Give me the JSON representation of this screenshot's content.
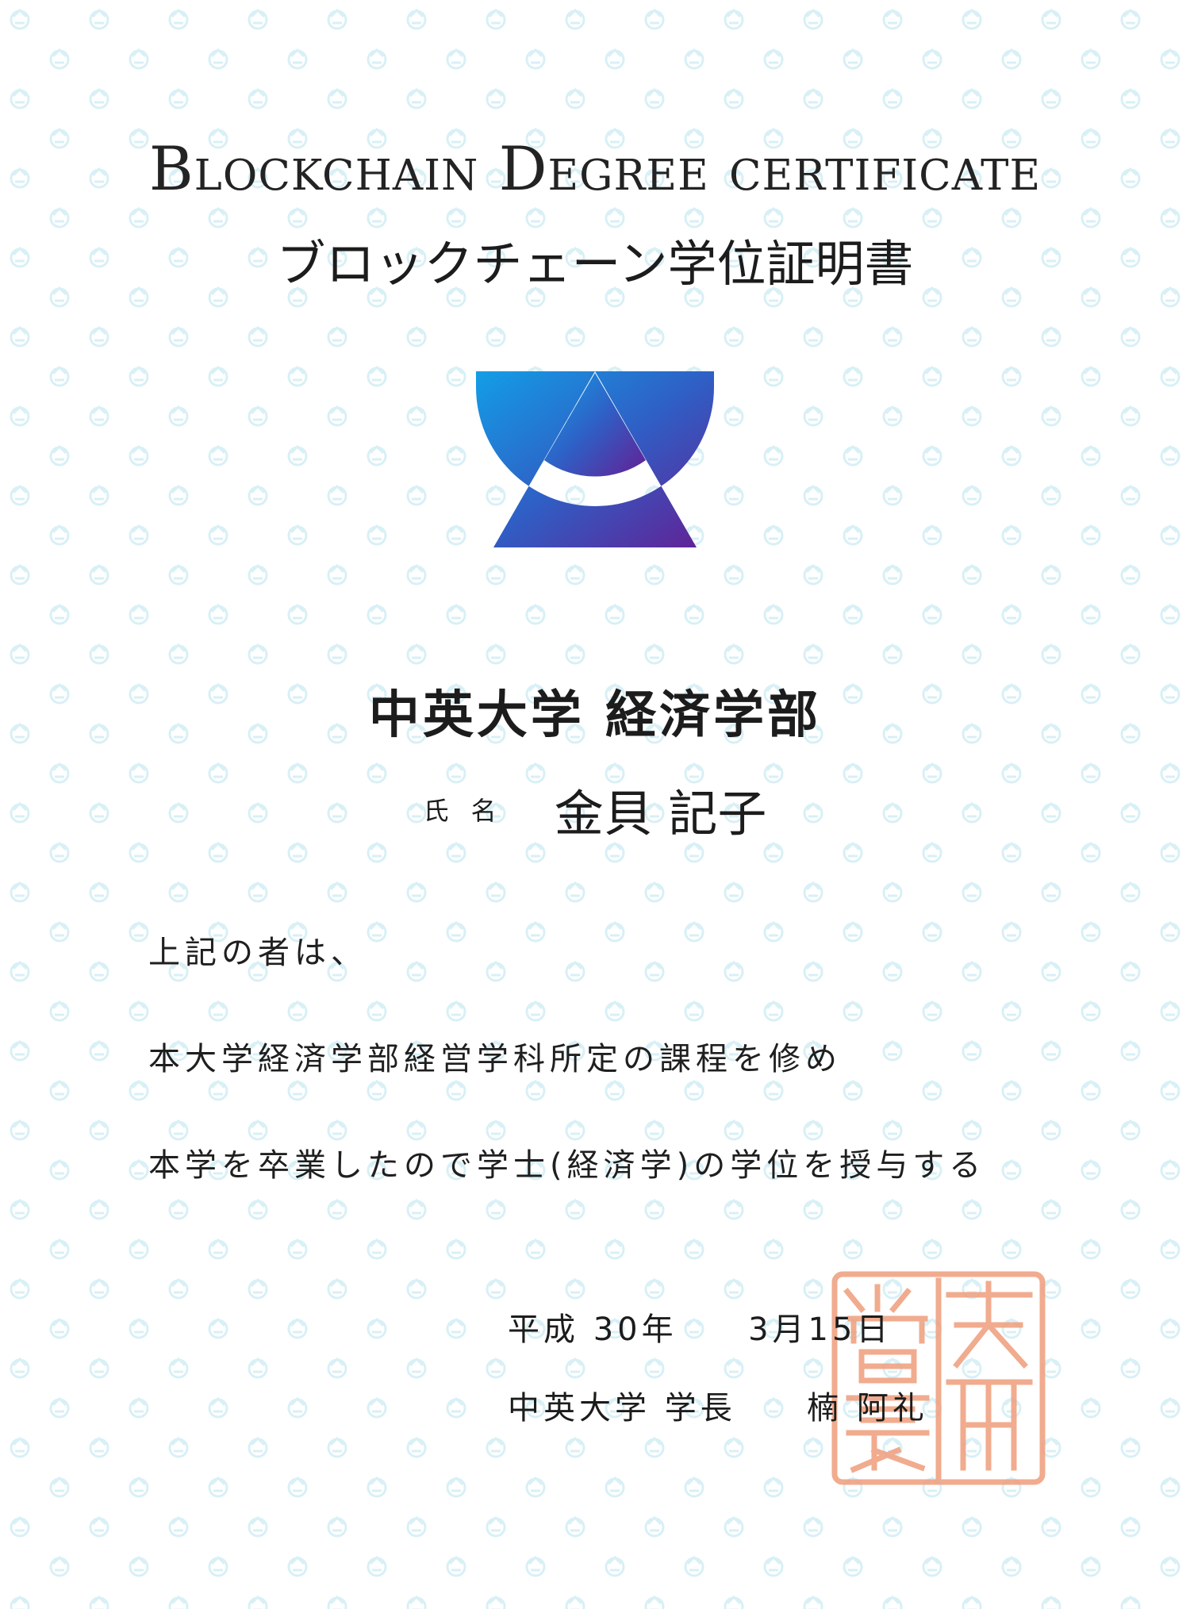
{
  "certificate": {
    "title_en": "Blockchain Degree certificate",
    "title_ja": "ブロックチェーン学位証明書",
    "university_faculty": "中英大学 経済学部",
    "name_label": "氏名",
    "name_value": "金貝 記子",
    "body_lines": [
      "上記の者は、",
      "本大学経済学部経営学科所定の課程を修め",
      "本学を卒業したので学士(経済学)の学位を授与する"
    ],
    "date": {
      "era": "平成",
      "year": "30年",
      "month_day": "3月15日"
    },
    "signatory": {
      "title": "中英大学 学長",
      "name": "楠 阿礼"
    }
  },
  "icons": {
    "logo": "university-emblem-triangle-circle",
    "seal": "red-square-seal-stamp",
    "background": "watermark-pattern"
  },
  "colors": {
    "logo_gradient_start": "#139ee6",
    "logo_gradient_mid": "#2f5fc5",
    "logo_gradient_end": "#641f94",
    "seal": "#f0a282",
    "watermark": "#d8f0f6",
    "text": "#1c1c1c"
  }
}
